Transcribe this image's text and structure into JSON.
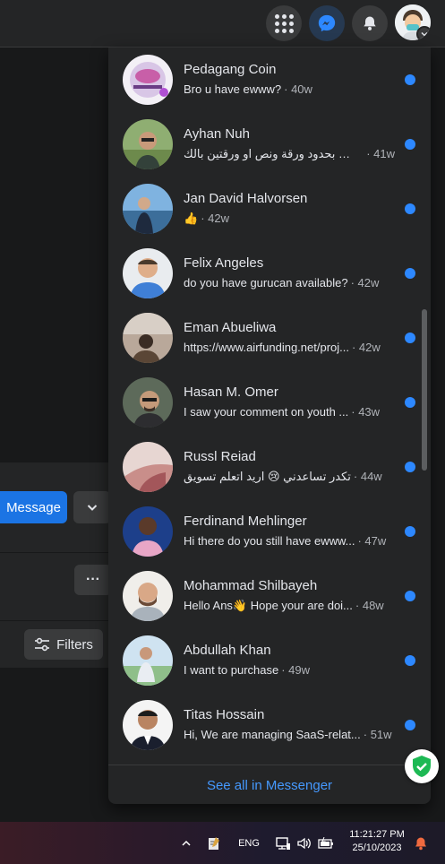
{
  "messenger": {
    "conversations": [
      {
        "name": "Pedagang Coin",
        "preview": "Bro u have ewww?",
        "time": "· 40w",
        "unread": true
      },
      {
        "name": "Ayhan Nuh",
        "preview": "يس بحدود ورقة ونص او ورقتين بالك...",
        "time": "· 41w",
        "unread": true
      },
      {
        "name": "Jan David Halvorsen",
        "preview": "👍",
        "time": "· 42w",
        "unread": true
      },
      {
        "name": "Felix Angeles",
        "preview": "do you have gurucan available?",
        "time": "· 42w",
        "unread": true
      },
      {
        "name": "Eman Abueliwa",
        "preview": "https://www.airfunding.net/proj...",
        "time": "· 42w",
        "unread": true
      },
      {
        "name": "Hasan M. Omer",
        "preview": "I saw your comment on youth ...",
        "time": "· 43w",
        "unread": true
      },
      {
        "name": "Russl Reiad",
        "preview": "تكدر تساعدني 😢 اريد اتعلم تسويق",
        "time": "· 44w",
        "unread": true
      },
      {
        "name": "Ferdinand Mehlinger",
        "preview": "Hi there do you still have ewww...",
        "time": "· 47w",
        "unread": true
      },
      {
        "name": "Mohammad Shilbayeh",
        "preview": "Hello Ans👋 Hope your are doi...",
        "time": "· 48w",
        "unread": true
      },
      {
        "name": "Abdullah Khan",
        "preview": "I want to purchase",
        "time": "· 49w",
        "unread": true
      },
      {
        "name": "Titas Hossain",
        "preview": "Hi, We are managing SaaS-relat...",
        "time": "· 51w",
        "unread": true
      }
    ],
    "see_all_label": "See all in Messenger"
  },
  "page": {
    "message_button": "Message",
    "filters_button": "Filters",
    "more_glyph": "···"
  },
  "taskbar": {
    "language": "ENG",
    "time": "11:21:27 PM",
    "date": "25/10/2023"
  },
  "colors": {
    "accent": "#1b74e4",
    "unread_dot": "#2d88ff",
    "link": "#4599ff",
    "panel": "#242526"
  }
}
